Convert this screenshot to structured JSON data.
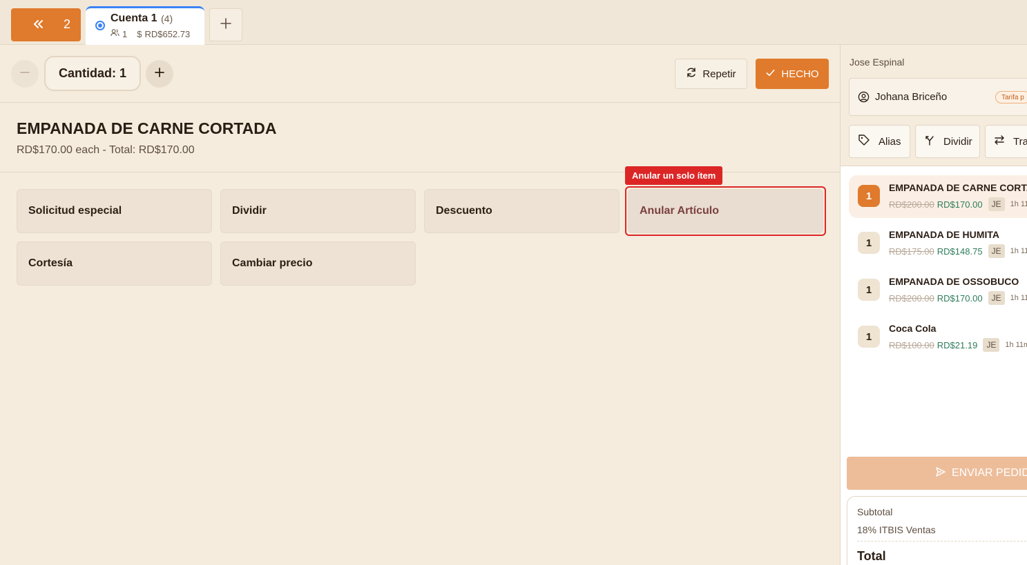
{
  "topbar": {
    "back_count": "2",
    "tab": {
      "title": "Cuenta 1",
      "count": "(4)",
      "guests": "1",
      "amount": "RD$652.73"
    }
  },
  "quantity": {
    "label": "Cantidad: 1"
  },
  "toolbar": {
    "repeat_label": "Repetir",
    "done_label": "HECHO"
  },
  "item": {
    "title": "EMPANADA DE CARNE CORTADA",
    "subtitle": "RD$170.00 each - Total: RD$170.00"
  },
  "actions": {
    "special_request": "Solicitud especial",
    "split": "Dividir",
    "discount": "Descuento",
    "void_item": "Anular Artículo",
    "courtesy": "Cortesía",
    "change_price": "Cambiar precio",
    "void_tooltip": "Anular un solo ítem"
  },
  "order_panel": {
    "waiter": "Jose Espinal",
    "customer_name": "Johana Briceño",
    "customer_tag": "Tarifa p",
    "buttons": {
      "alias": "Alias",
      "split": "Dividir",
      "transfer": "Tra"
    },
    "items": [
      {
        "qty": "1",
        "name": "EMPANADA DE CARNE CORTA",
        "old_price": "RD$200.00",
        "new_price": "RD$170.00",
        "user": "JE",
        "time": "1h 11"
      },
      {
        "qty": "1",
        "name": "EMPANADA DE HUMITA",
        "old_price": "RD$175.00",
        "new_price": "RD$148.75",
        "user": "JE",
        "time": "1h 11r"
      },
      {
        "qty": "1",
        "name": "EMPANADA DE OSSOBUCO",
        "old_price": "RD$200.00",
        "new_price": "RD$170.00",
        "user": "JE",
        "time": "1h 11r"
      },
      {
        "qty": "1",
        "name": "Coca Cola",
        "old_price": "RD$100.00",
        "new_price": "RD$21.19",
        "user": "JE",
        "time": "1h 11m"
      }
    ],
    "send_label": "ENVIAR PEDID",
    "subtotal_label": "Subtotal",
    "itbis_label": "18% ITBIS Ventas",
    "total_label": "Total"
  },
  "colors": {
    "accent": "#e07a2c",
    "alert": "#dc2626",
    "tab_indicator": "#3b82f6",
    "discount_price": "#2e7d5b"
  }
}
